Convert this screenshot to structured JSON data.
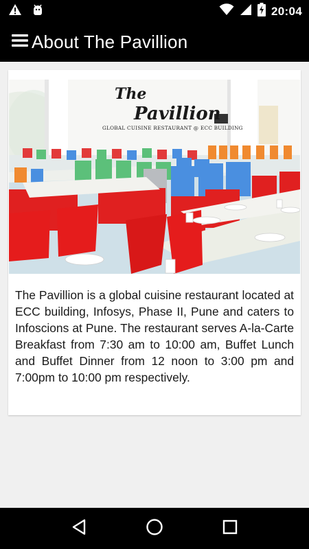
{
  "status_bar": {
    "time": "20:04",
    "icons": [
      "warning-icon",
      "android-debug-icon",
      "wifi-icon",
      "cellular-signal-icon",
      "battery-charging-icon"
    ]
  },
  "app_bar": {
    "title": "About The Pavillion",
    "menu_icon": "menu-icon"
  },
  "card": {
    "image_alt": "The Pavillion restaurant dining hall",
    "logo_title": "The Pavillion",
    "logo_subtitle": "GLOBAL CUISINE RESTAURANT @ ECC BUILDING",
    "description": "The Pavillion is a global cuisine restaurant located at ECC building, Infosys, Phase II, Pune and caters to Infoscions at Pune. The restaurant serves A-la-Carte Breakfast from 7:30 am to 10:00 am, Buffet Lunch and Buffet Dinner from 12 noon to 3:00 pm and 7:00pm to 10:00 pm respectively."
  },
  "nav_bar": {
    "back_icon": "back-icon",
    "home_icon": "home-icon",
    "recents_icon": "recents-icon"
  },
  "colors": {
    "bar_background": "#000000",
    "content_background": "#f0f0f0",
    "card_background": "#ffffff",
    "text": "#1a1a1a",
    "chair_red": "#e02020",
    "chair_blue": "#4a8fe0",
    "chair_green": "#5cc07a",
    "chair_orange": "#f08a30"
  }
}
